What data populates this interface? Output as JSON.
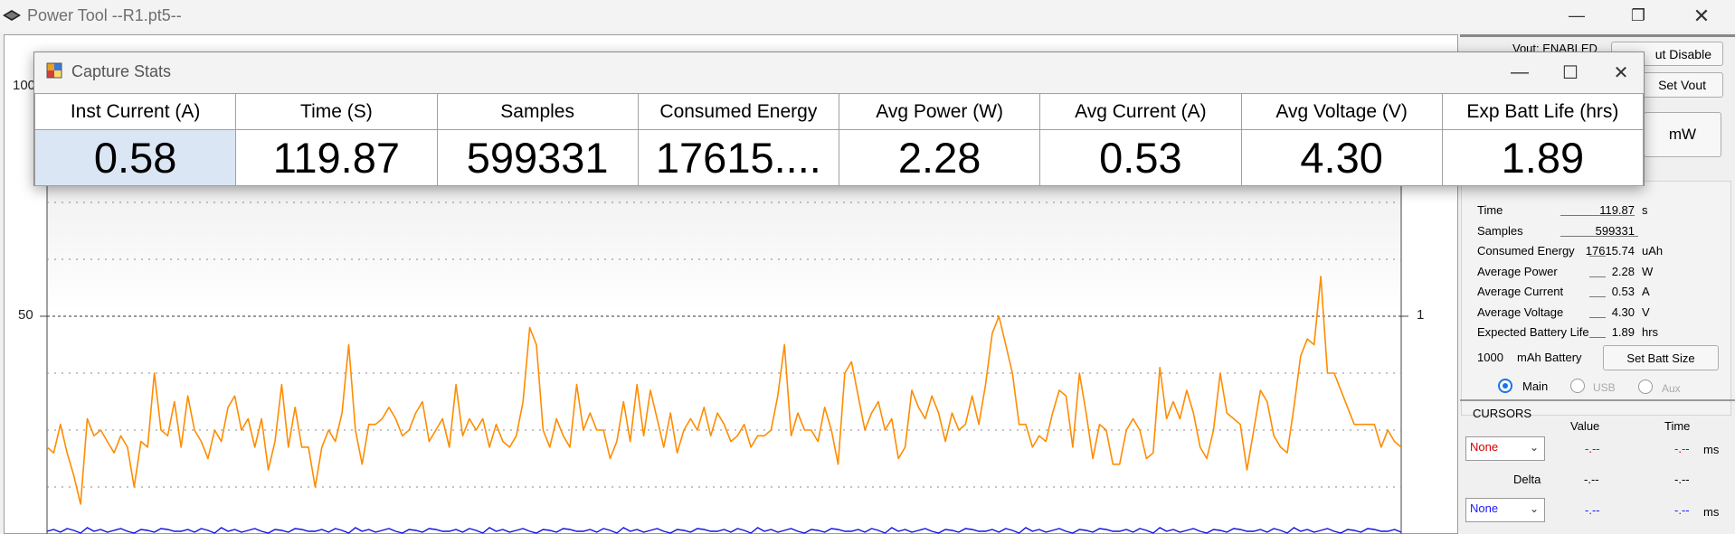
{
  "app": {
    "title": "Power Tool --R1.pt5--"
  },
  "plot": {
    "y_ticks_left": [
      "100",
      "50"
    ],
    "y_ticks_right": [
      "1"
    ],
    "colors": {
      "current": "#ff8c00",
      "voltage": "#1010e0",
      "grid": "#888888"
    }
  },
  "chart_data": {
    "type": "line",
    "title": "",
    "ylim": [
      0,
      100
    ],
    "series": [
      {
        "values": [
          27,
          26,
          31,
          26,
          22,
          17,
          32,
          29,
          30,
          28,
          26,
          29,
          27,
          20,
          28,
          27,
          40,
          30,
          29,
          35,
          27,
          36,
          30,
          28,
          25,
          30,
          28,
          34,
          36,
          30,
          32,
          27,
          32,
          23,
          28,
          38,
          27,
          34,
          27,
          27,
          20,
          27,
          30,
          28,
          33,
          45,
          30,
          24,
          31,
          31,
          32,
          34,
          32,
          29,
          30,
          33,
          35,
          28,
          30,
          32,
          27,
          38,
          29,
          32,
          30,
          32,
          27,
          31,
          28,
          27,
          29,
          35,
          48,
          45,
          30,
          27,
          32,
          29,
          27,
          38,
          30,
          33,
          30,
          30,
          25,
          28,
          35,
          28,
          38,
          29,
          37,
          32,
          27,
          33,
          26,
          30,
          32,
          30,
          34,
          29,
          33,
          31,
          28,
          29,
          31,
          27,
          29,
          29,
          30,
          36,
          45,
          29,
          33,
          30,
          30,
          28,
          34,
          30,
          24,
          40,
          42,
          36,
          30,
          33,
          35,
          30,
          32,
          25,
          27,
          37,
          34,
          32,
          36,
          33,
          28,
          33,
          30,
          31,
          36,
          31,
          38,
          47,
          50,
          45,
          40,
          31,
          31,
          27,
          29,
          28,
          33,
          37,
          36,
          27,
          40,
          33,
          25,
          31,
          30,
          24,
          24,
          30,
          32,
          30,
          25,
          26,
          41,
          32,
          35,
          32,
          37,
          33,
          27,
          25,
          30,
          40,
          33,
          32,
          31,
          23,
          30,
          37,
          35,
          29,
          27,
          26,
          34,
          43,
          46,
          45,
          57,
          40,
          40,
          37,
          34,
          31,
          31,
          31,
          31,
          27,
          30,
          28,
          27
        ]
      },
      {
        "values": [
          1,
          1,
          1,
          1,
          1,
          1,
          1,
          1,
          1,
          1,
          1,
          1,
          1,
          1,
          1,
          1,
          1,
          1,
          1,
          1,
          1,
          1,
          1,
          1,
          1,
          1,
          1,
          1,
          1,
          1,
          1,
          1,
          1,
          1,
          1,
          1,
          1,
          1,
          1,
          1,
          1,
          1,
          1,
          1,
          1,
          1,
          1,
          1,
          1,
          1,
          1,
          1,
          1,
          1,
          1,
          1,
          1,
          1,
          1,
          1,
          1,
          1,
          1,
          1,
          1,
          1,
          1,
          1,
          1,
          1,
          1,
          1,
          1,
          1,
          1,
          1,
          1,
          1,
          1,
          1,
          1,
          1,
          1,
          1,
          1,
          1,
          1,
          1,
          1,
          1,
          1,
          1,
          1,
          1,
          1,
          1,
          1,
          1,
          1,
          1,
          1,
          1,
          1,
          1,
          1,
          1,
          1,
          1,
          1,
          1,
          1,
          1,
          1,
          1,
          1,
          1,
          1,
          1,
          1,
          1,
          1,
          1,
          1,
          1,
          1,
          1,
          1,
          1,
          1,
          1,
          1,
          1,
          1,
          1,
          1,
          1,
          1,
          1,
          1,
          1,
          1,
          1,
          1,
          1,
          1,
          1,
          1,
          1,
          1,
          1,
          1,
          1,
          1,
          1,
          1,
          1,
          1,
          1,
          1,
          1,
          1,
          1,
          1,
          1,
          1,
          1,
          1,
          1,
          1,
          1,
          1,
          1,
          1,
          1,
          1,
          1,
          1,
          1,
          1,
          1,
          1,
          1,
          1,
          1,
          1,
          1,
          1,
          1,
          1,
          1,
          1,
          1,
          1,
          1,
          1,
          1,
          1,
          1,
          1,
          1,
          1,
          1,
          1
        ]
      }
    ]
  },
  "right_panel": {
    "top_buttons": [
      "ut Disable",
      "Set Vout"
    ],
    "vout_label": "Vout: ENABLED",
    "unit_button": "mW",
    "stats": [
      {
        "label": "Time",
        "value": "119.87",
        "unit": "s"
      },
      {
        "label": "Samples",
        "value": "599331",
        "unit": ""
      },
      {
        "label": "Consumed Energy",
        "value": "17615.74",
        "unit": "uAh"
      },
      {
        "label": "Average Power",
        "value": "2.28",
        "unit": "W"
      },
      {
        "label": "Average Current",
        "value": "0.53",
        "unit": "A"
      },
      {
        "label": "Average Voltage",
        "value": "4.30",
        "unit": "V"
      },
      {
        "label": "Expected Battery Life",
        "value": "1.89",
        "unit": "hrs"
      }
    ],
    "battery": {
      "capacity": "1000",
      "label": "mAh Battery",
      "button": "Set Batt Size"
    },
    "channels": [
      {
        "label": "Main",
        "selected": true
      },
      {
        "label": "USB",
        "selected": false
      },
      {
        "label": "Aux",
        "selected": false
      }
    ],
    "cursors": {
      "title": "CURSORS",
      "col_value": "Value",
      "col_time": "Time",
      "delta_label": "Delta",
      "row1": {
        "select": "None",
        "value": "-.--",
        "time": "-.--",
        "unit": "ms"
      },
      "delta": {
        "value": "-.--",
        "time": "-.--"
      },
      "row2": {
        "select": "None",
        "value": "-.--",
        "time": "-.--",
        "unit": "ms"
      }
    }
  },
  "capture_stats": {
    "title": "Capture Stats",
    "headers": [
      "Inst Current (A)",
      "Time (S)",
      "Samples",
      "Consumed Energy",
      "Avg Power (W)",
      "Avg Current (A)",
      "Avg Voltage (V)",
      "Exp Batt Life (hrs)"
    ],
    "values": [
      "0.58",
      "119.87",
      "599331",
      "17615....",
      "2.28",
      "0.53",
      "4.30",
      "1.89"
    ]
  }
}
